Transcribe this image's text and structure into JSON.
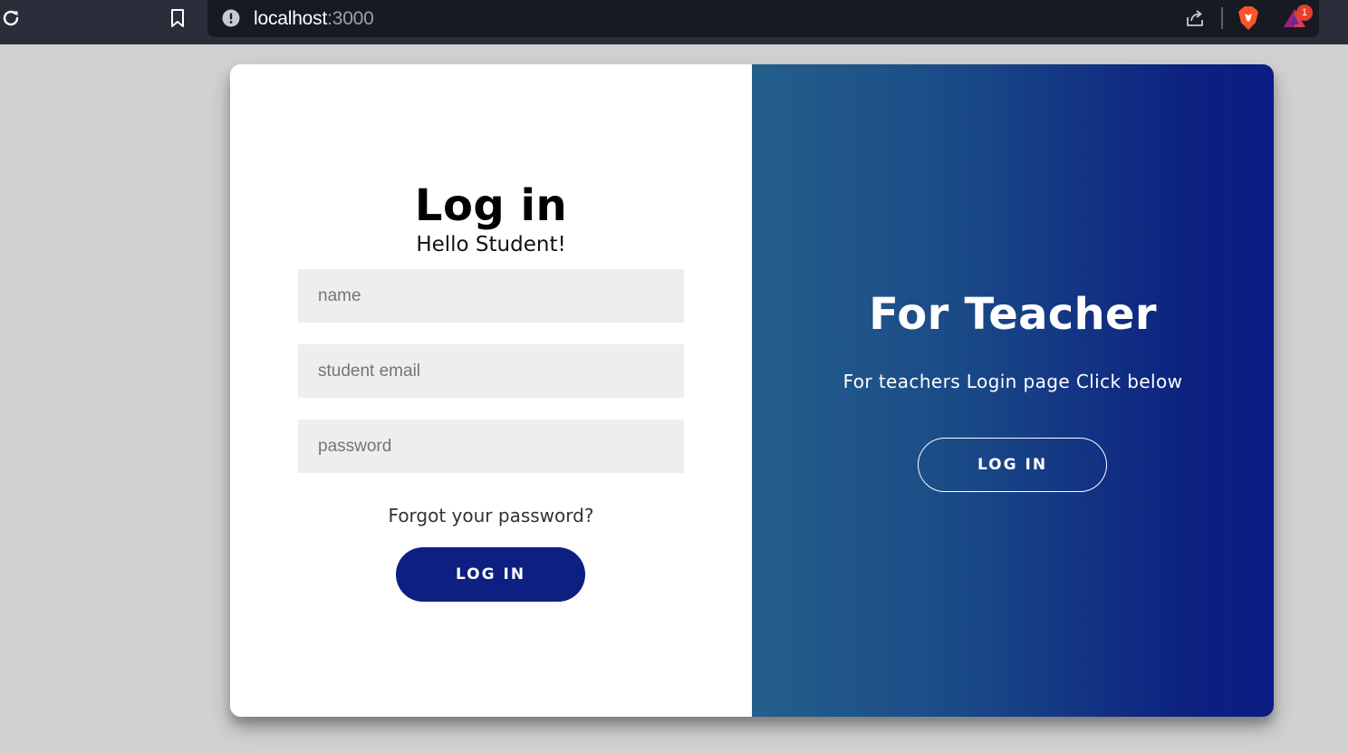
{
  "browser": {
    "url_host": "localhost",
    "url_port": ":3000",
    "rewards_badge": "1",
    "icons": [
      "reload-icon",
      "bookmark-icon",
      "info-icon",
      "share-icon",
      "brave-lion-icon",
      "brave-rewards-icon"
    ]
  },
  "student_login": {
    "title": "Log in",
    "subtitle": "Hello Student!",
    "name_placeholder": "name",
    "email_placeholder": "student email",
    "password_placeholder": "password",
    "forgot_text": "Forgot your password?",
    "button_label": "LOG IN",
    "button_color": "#0d1f80"
  },
  "teacher_panel": {
    "title": "For Teacher",
    "subtitle": "For teachers Login page Click below",
    "button_label": "LOG IN",
    "gradient_start": "#245f8a",
    "gradient_end": "#0b1d84"
  }
}
